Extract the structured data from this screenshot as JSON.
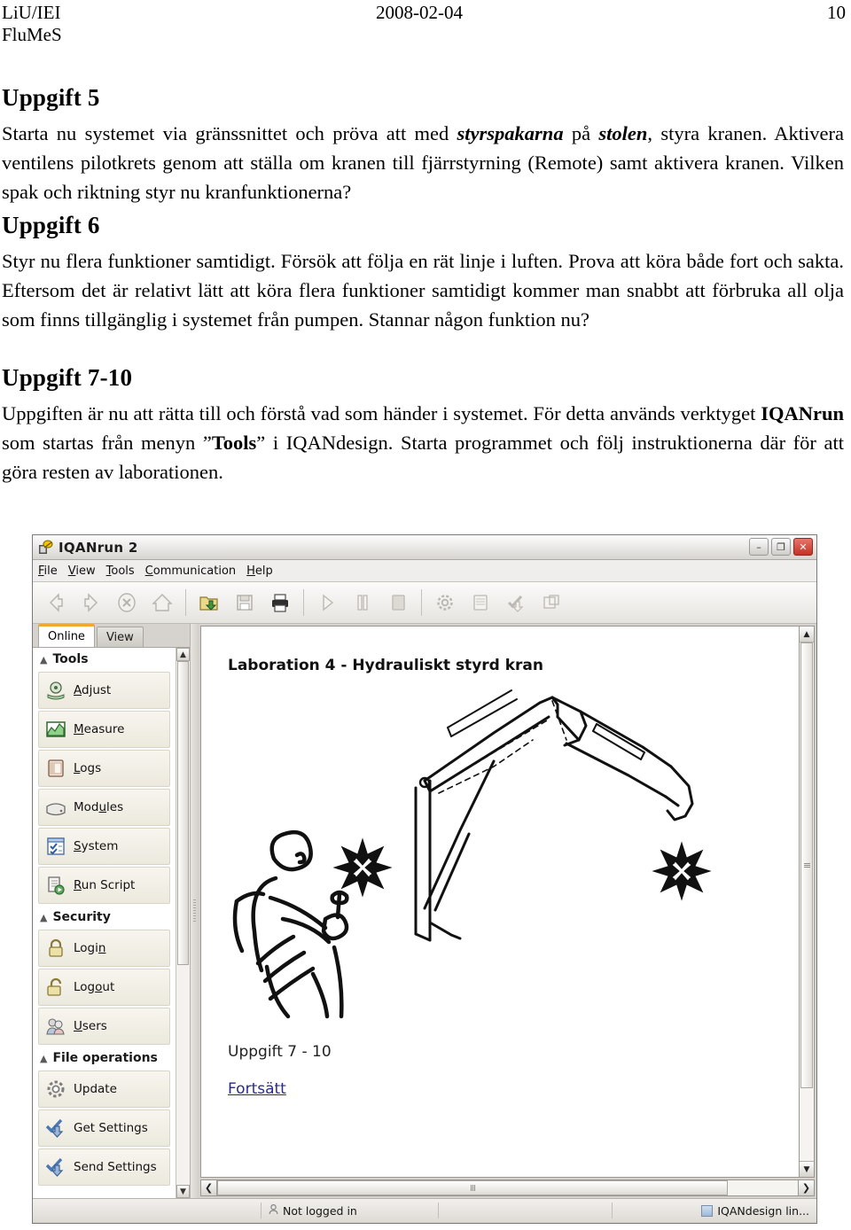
{
  "doc_header": {
    "org_line1": "LiU/IEI",
    "org_line2": "FluMeS",
    "date": "2008-02-04",
    "page_number": "10"
  },
  "sections": [
    {
      "title": "Uppgift 5",
      "paragraphs": [
        "Starta nu systemet via gränssnittet och pröva att med ",
        "styrspakarna",
        " på ",
        "stolen",
        ", styra kranen. Aktivera ventilens pilotkrets genom att ställa om kranen till fjärrstyrning (Remote) samt aktivera kranen. Vilken spak och riktning styr nu kranfunktionerna?"
      ]
    },
    {
      "title": "Uppgift 6",
      "text": "Styr nu flera funktioner samtidigt. Försök att följa en rät linje i luften. Prova att köra både fort och sakta. Eftersom det är relativt lätt att köra flera funktioner samtidigt kommer man snabbt att förbruka all olja som finns tillgänglig i systemet från pumpen. Stannar någon funktion nu?"
    },
    {
      "title": "Uppgift 7-10",
      "text_parts": {
        "p1": "Uppgiften är nu att rätta till och förstå vad som händer i systemet. För detta används verktyget ",
        "bold1": "IQANrun",
        "p2": " som startas från menyn ”",
        "bold2": "Tools",
        "p3": "” i IQANdesign. Starta programmet och följ instruktionerna där för att göra resten av laborationen."
      }
    }
  ],
  "app": {
    "title": "IQANrun 2",
    "window_buttons": {
      "minimize": "–",
      "maximize": "❐",
      "close": "✕"
    },
    "menu": [
      {
        "mnemonic": "F",
        "rest": "ile"
      },
      {
        "mnemonic": "V",
        "rest": "iew"
      },
      {
        "mnemonic": "T",
        "rest": "ools"
      },
      {
        "mnemonic": "C",
        "rest": "ommunication"
      },
      {
        "mnemonic": "H",
        "rest": "elp"
      }
    ],
    "toolbar": [
      {
        "name": "back-icon",
        "enabled": false
      },
      {
        "name": "forward-icon",
        "enabled": false
      },
      {
        "name": "stop-icon",
        "enabled": false
      },
      {
        "name": "home-icon",
        "enabled": false
      },
      {
        "name": "open-project-icon",
        "enabled": true
      },
      {
        "name": "save-icon",
        "enabled": false
      },
      {
        "name": "print-icon",
        "enabled": true
      },
      {
        "name": "play-icon",
        "enabled": false
      },
      {
        "name": "pause-icon",
        "enabled": false
      },
      {
        "name": "stop-recording-icon",
        "enabled": false
      },
      {
        "name": "settings-gear-icon",
        "enabled": false
      },
      {
        "name": "log-icon",
        "enabled": false
      },
      {
        "name": "apply-settings-icon",
        "enabled": false
      },
      {
        "name": "external-window-icon",
        "enabled": false
      }
    ],
    "sidebar": {
      "tabs": [
        {
          "label": "Online",
          "active": true
        },
        {
          "label": "View",
          "active": false
        }
      ],
      "groups": [
        {
          "title": "Tools",
          "items": [
            {
              "mnemonic": "A",
              "rest": "djust",
              "icon": "adjust-icon"
            },
            {
              "mnemonic": "M",
              "rest": "easure",
              "icon": "measure-icon"
            },
            {
              "mnemonic": "L",
              "rest": "ogs",
              "icon": "logs-icon"
            },
            {
              "pre": "Mod",
              "mnemonic": "u",
              "rest": "les",
              "icon": "modules-icon"
            },
            {
              "mnemonic": "S",
              "rest": "ystem",
              "icon": "system-icon"
            },
            {
              "mnemonic": "R",
              "rest": "un Script",
              "icon": "run-script-icon"
            }
          ]
        },
        {
          "title": "Security",
          "items": [
            {
              "pre": "Logi",
              "mnemonic": "n",
              "rest": "",
              "icon": "lock-closed-icon"
            },
            {
              "pre": "Log",
              "mnemonic": "o",
              "rest": "ut",
              "icon": "lock-open-icon"
            },
            {
              "mnemonic": "U",
              "rest": "sers",
              "icon": "users-icon"
            }
          ]
        },
        {
          "title": "File operations",
          "items": [
            {
              "pre": "",
              "mnemonic": "",
              "rest": "Update",
              "icon": "gear-icon"
            },
            {
              "pre": "",
              "mnemonic": "",
              "rest": "Get Settings",
              "icon": "get-settings-icon"
            },
            {
              "pre": "",
              "mnemonic": "",
              "rest": "Send Settings",
              "icon": "send-settings-icon"
            }
          ]
        }
      ]
    },
    "canvas": {
      "title": "Laboration 4 - Hydrauliskt styrd kran",
      "subtitle": "Uppgift 7 - 10",
      "link": "Fortsätt",
      "illustration": "crane-operator-drawing"
    },
    "statusbar": {
      "login_status": "Not logged in",
      "link_status": "IQANdesign lin..."
    }
  },
  "colors": {
    "tab_accent": "#f0a830",
    "close_button": "#c33225",
    "link": "#2a2a8c"
  }
}
